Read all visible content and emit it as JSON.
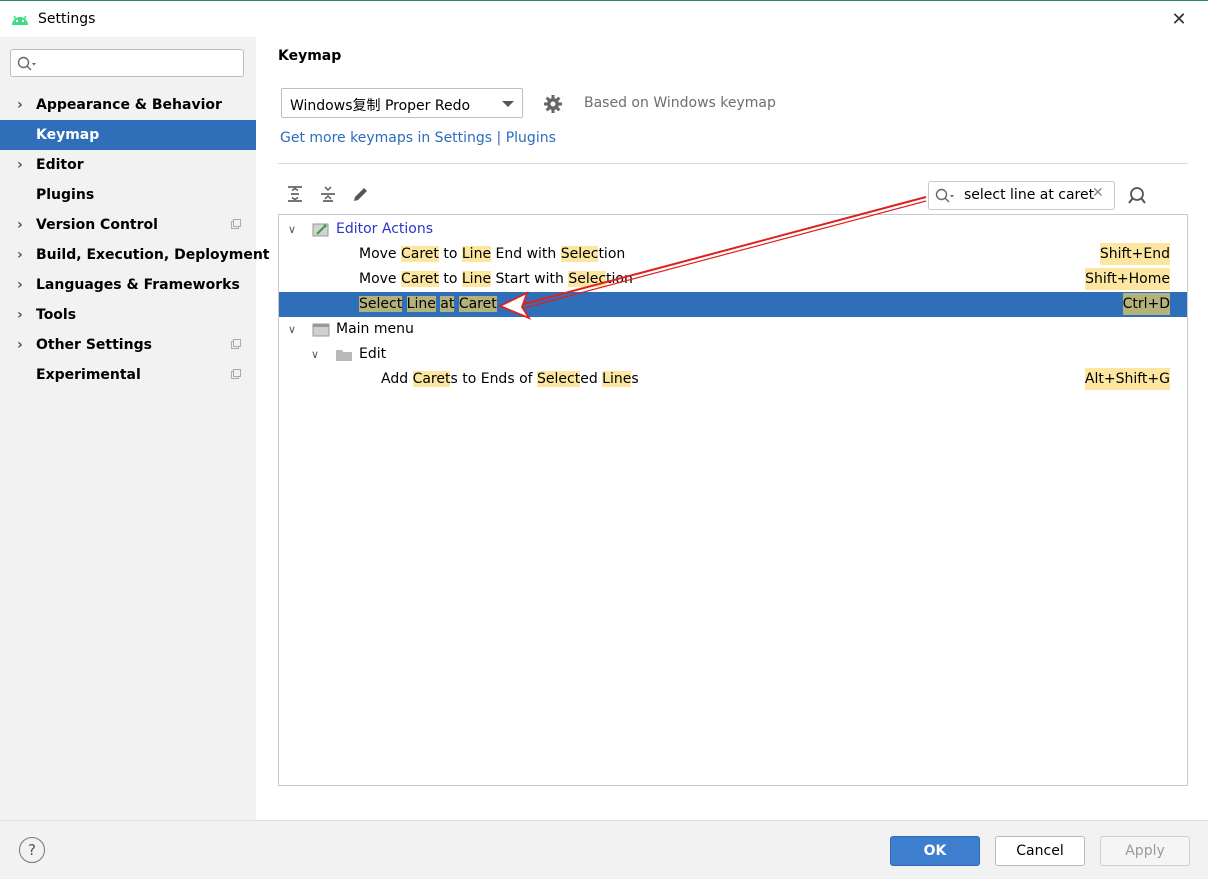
{
  "window": {
    "title": "Settings",
    "close_label": "✕"
  },
  "sidebar": {
    "search_value": "",
    "items": [
      {
        "label": "Appearance & Behavior",
        "expandable": true,
        "selected": false
      },
      {
        "label": "Keymap",
        "expandable": false,
        "selected": true
      },
      {
        "label": "Editor",
        "expandable": true,
        "selected": false
      },
      {
        "label": "Plugins",
        "expandable": false,
        "selected": false
      },
      {
        "label": "Version Control",
        "expandable": true,
        "selected": false
      },
      {
        "label": "Build, Execution, Deployment",
        "expandable": true,
        "selected": false
      },
      {
        "label": "Languages & Frameworks",
        "expandable": true,
        "selected": false
      },
      {
        "label": "Tools",
        "expandable": true,
        "selected": false
      },
      {
        "label": "Other Settings",
        "expandable": true,
        "selected": false
      },
      {
        "label": "Experimental",
        "expandable": false,
        "selected": false
      }
    ]
  },
  "main": {
    "heading": "Keymap",
    "keymap_select": "Windows复制 Proper Redo",
    "based_on": "Based on Windows keymap",
    "link": "Get more keymaps in Settings | Plugins",
    "filter_value": "select line at caret",
    "filter_clear": "✕",
    "tree": {
      "editor_actions": "Editor Actions",
      "move_end_shortcut": "Shift+End",
      "move_start_shortcut": "Shift+Home",
      "select_line_shortcut": "Ctrl+D",
      "main_menu": "Main menu",
      "edit": "Edit",
      "add_carets_shortcut": "Alt+Shift+G"
    }
  },
  "footer": {
    "help": "?",
    "ok": "OK",
    "cancel": "Cancel",
    "apply": "Apply"
  },
  "colors": {
    "accent": "#2f6fba",
    "highlight": "#fde7a0",
    "annotation_arrow": "#e02020"
  }
}
